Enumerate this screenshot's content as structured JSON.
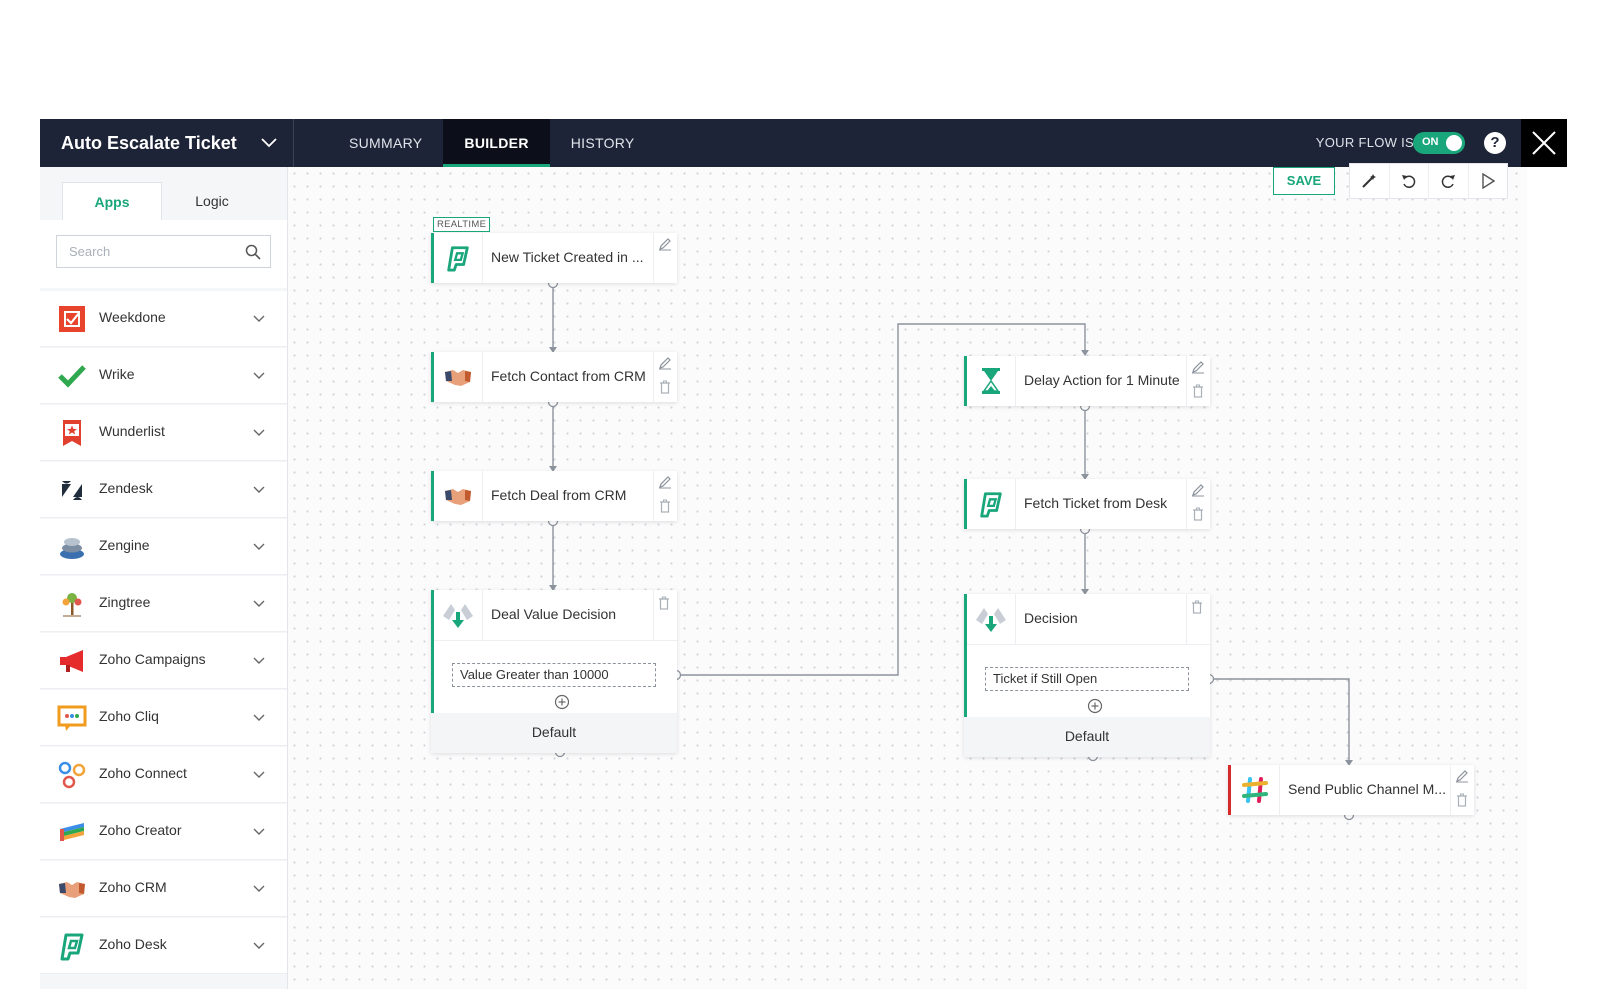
{
  "header": {
    "flow_title": "Auto Escalate Ticket",
    "tabs": [
      {
        "label": "SUMMARY",
        "active": false
      },
      {
        "label": "BUILDER",
        "active": true
      },
      {
        "label": "HISTORY",
        "active": false
      }
    ],
    "flow_status_label": "YOUR FLOW IS",
    "toggle_label": "ON",
    "help_label": "?"
  },
  "sidebar": {
    "tabs": [
      {
        "label": "Apps",
        "active": true
      },
      {
        "label": "Logic",
        "active": false
      }
    ],
    "search": {
      "placeholder": "Search",
      "value": ""
    },
    "apps": [
      {
        "name": "Weekdone",
        "icon": "weekdone-icon"
      },
      {
        "name": "Wrike",
        "icon": "wrike-icon"
      },
      {
        "name": "Wunderlist",
        "icon": "wunderlist-icon"
      },
      {
        "name": "Zendesk",
        "icon": "zendesk-icon"
      },
      {
        "name": "Zengine",
        "icon": "zengine-icon"
      },
      {
        "name": "Zingtree",
        "icon": "zingtree-icon"
      },
      {
        "name": "Zoho Campaigns",
        "icon": "zoho-campaigns-icon"
      },
      {
        "name": "Zoho Cliq",
        "icon": "zoho-cliq-icon"
      },
      {
        "name": "Zoho Connect",
        "icon": "zoho-connect-icon"
      },
      {
        "name": "Zoho Creator",
        "icon": "zoho-creator-icon"
      },
      {
        "name": "Zoho CRM",
        "icon": "zoho-crm-icon"
      },
      {
        "name": "Zoho Desk",
        "icon": "zoho-desk-icon"
      }
    ]
  },
  "toolbar": {
    "save_label": "SAVE",
    "tools": [
      "magic-wand-icon",
      "undo-icon",
      "redo-icon",
      "play-icon"
    ]
  },
  "canvas": {
    "trigger_badge": "REALTIME",
    "nodes": {
      "new_ticket": {
        "title": "New Ticket Created in ...",
        "icon": "zoho-desk-icon"
      },
      "fetch_contact": {
        "title": "Fetch Contact from CRM",
        "icon": "zoho-crm-icon"
      },
      "fetch_deal": {
        "title": "Fetch Deal from CRM",
        "icon": "zoho-crm-icon"
      },
      "deal_decision": {
        "title": "Deal Value Decision",
        "icon": "decision-icon",
        "condition": "Value Greater than 10000",
        "default_label": "Default"
      },
      "delay": {
        "title": "Delay Action for 1 Minute",
        "icon": "hourglass-icon"
      },
      "fetch_ticket": {
        "title": "Fetch Ticket from Desk",
        "icon": "zoho-desk-icon"
      },
      "decision": {
        "title": "Decision",
        "icon": "decision-icon",
        "condition": "Ticket if Still Open",
        "default_label": "Default"
      },
      "slack": {
        "title": "Send Public Channel M...",
        "icon": "slack-icon"
      }
    }
  },
  "colors": {
    "header_bg": "#1e2437",
    "accent_green": "#1aa67b",
    "slack_red": "#d72b2b"
  }
}
